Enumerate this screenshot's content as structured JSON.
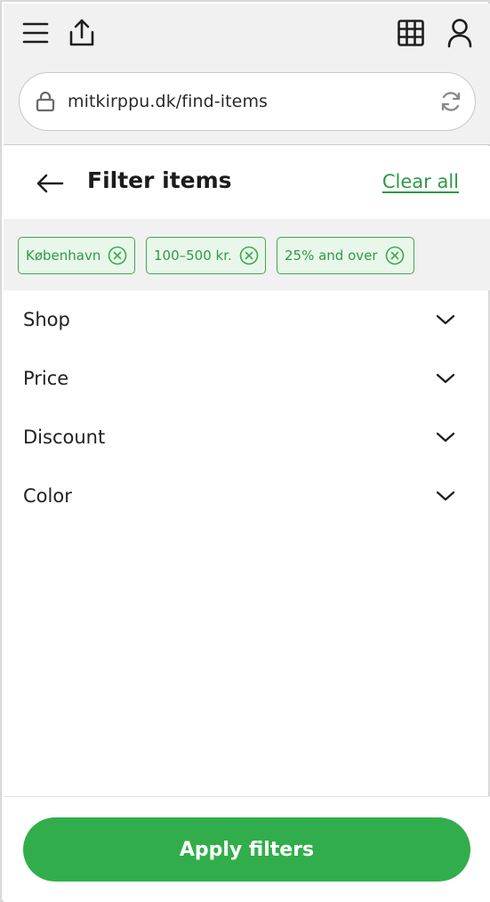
{
  "browser": {
    "url": "mitkirppu.dk/find-items",
    "icons": {
      "menu": "hamburger-menu-icon",
      "share": "share-icon",
      "grid": "grid-icon",
      "profile": "user-icon",
      "lock": "lock-icon",
      "reload": "reload-icon"
    }
  },
  "header": {
    "title": "Filter items",
    "clear_all": "Clear all",
    "back_icon": "arrow-left-icon"
  },
  "active_filters": [
    {
      "label": "København"
    },
    {
      "label": "100–500 kr."
    },
    {
      "label": "25% and over"
    }
  ],
  "filters": [
    {
      "label": "Shop"
    },
    {
      "label": "Price"
    },
    {
      "label": "Discount"
    },
    {
      "label": "Color"
    }
  ],
  "footer": {
    "apply_label": "Apply filters"
  },
  "colors": {
    "accent": "#31ae4b",
    "chip_bg": "#e9f7ea",
    "chip_text": "#2f9a45",
    "chrome_bg": "#f1f1f1"
  }
}
